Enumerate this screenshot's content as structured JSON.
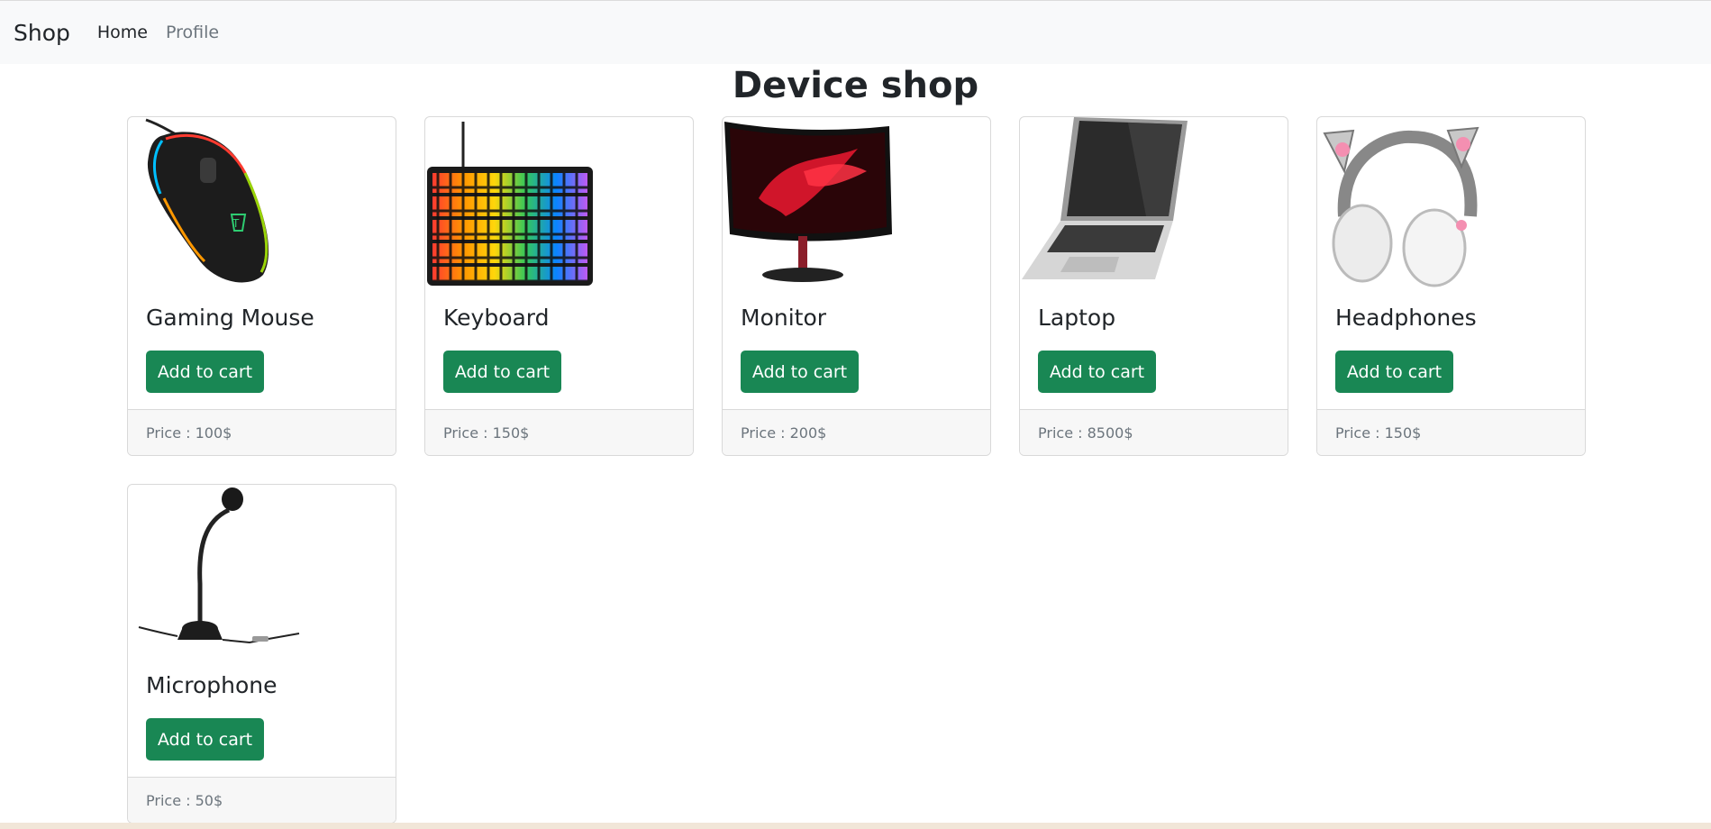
{
  "navbar": {
    "brand": "Shop",
    "links": [
      {
        "label": "Home",
        "active": true
      },
      {
        "label": "Profile",
        "active": false
      }
    ]
  },
  "page": {
    "title": "Device shop"
  },
  "products": [
    {
      "name": "Gaming Mouse",
      "button": "Add to cart",
      "price": "Price : 100$",
      "image_icon": "gaming-mouse-image"
    },
    {
      "name": "Keyboard",
      "button": "Add to cart",
      "price": "Price : 150$",
      "image_icon": "keyboard-image"
    },
    {
      "name": "Monitor",
      "button": "Add to cart",
      "price": "Price : 200$",
      "image_icon": "monitor-image"
    },
    {
      "name": "Laptop",
      "button": "Add to cart",
      "price": "Price : 8500$",
      "image_icon": "laptop-image"
    },
    {
      "name": "Headphones",
      "button": "Add to cart",
      "price": "Price : 150$",
      "image_icon": "headphones-image"
    },
    {
      "name": "Microphone",
      "button": "Add to cart",
      "price": "Price : 50$",
      "image_icon": "microphone-image"
    }
  ],
  "colors": {
    "button": "#198754",
    "navbar": "#f8f9fa",
    "footer": "#f7f7f7"
  }
}
